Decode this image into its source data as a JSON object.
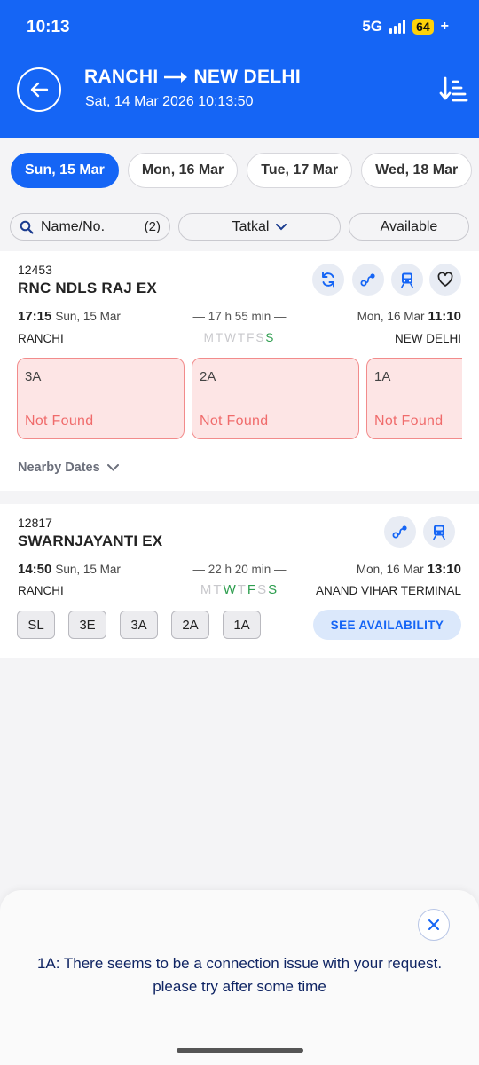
{
  "status_bar": {
    "time": "10:13",
    "network": "5G",
    "battery": "64"
  },
  "header": {
    "origin": "RANCHI",
    "destination": "NEW DELHI",
    "datetime": "Sat, 14 Mar 2026 10:13:50"
  },
  "date_tabs": [
    {
      "label": "Sun, 15 Mar"
    },
    {
      "label": "Mon, 16 Mar"
    },
    {
      "label": "Tue, 17 Mar"
    },
    {
      "label": "Wed, 18 Mar"
    }
  ],
  "filters": {
    "search_label": "Name/No.",
    "search_count": "(2)",
    "quota": "Tatkal",
    "availability": "Available"
  },
  "trains": [
    {
      "number": "12453",
      "name": "RNC NDLS RAJ EX",
      "dep_time": "17:15",
      "dep_date": "Sun, 15 Mar",
      "duration": "— 17 h 55 min —",
      "arr_date": "Mon, 16 Mar",
      "arr_time": "11:10",
      "from": "RANCHI",
      "to": "NEW DELHI",
      "days": [
        "M",
        "T",
        "W",
        "T",
        "F",
        "S",
        "S"
      ],
      "classes": [
        {
          "cls": "3A",
          "status": "Not Found"
        },
        {
          "cls": "2A",
          "status": "Not Found"
        },
        {
          "cls": "1A",
          "status": "Not Found"
        }
      ],
      "nearby_label": "Nearby Dates"
    },
    {
      "number": "12817",
      "name": "SWARNJAYANTI EX",
      "dep_time": "14:50",
      "dep_date": "Sun, 15 Mar",
      "duration": "— 22 h 20 min —",
      "arr_date": "Mon, 16 Mar",
      "arr_time": "13:10",
      "from": "RANCHI",
      "to": "ANAND VIHAR TERMINAL",
      "days": [
        "M",
        "T",
        "W",
        "T",
        "F",
        "S",
        "S"
      ],
      "classes": [
        "SL",
        "3E",
        "3A",
        "2A",
        "1A"
      ],
      "see_availability": "SEE AVAILABILITY"
    }
  ],
  "toast": {
    "message": "1A: There seems to be a connection issue with your request. please try after some time"
  },
  "colors": {
    "primary": "#1565f5",
    "error_bg": "#fde5e5",
    "error_border": "#f28b8b",
    "running_day": "#2e9e4f"
  }
}
